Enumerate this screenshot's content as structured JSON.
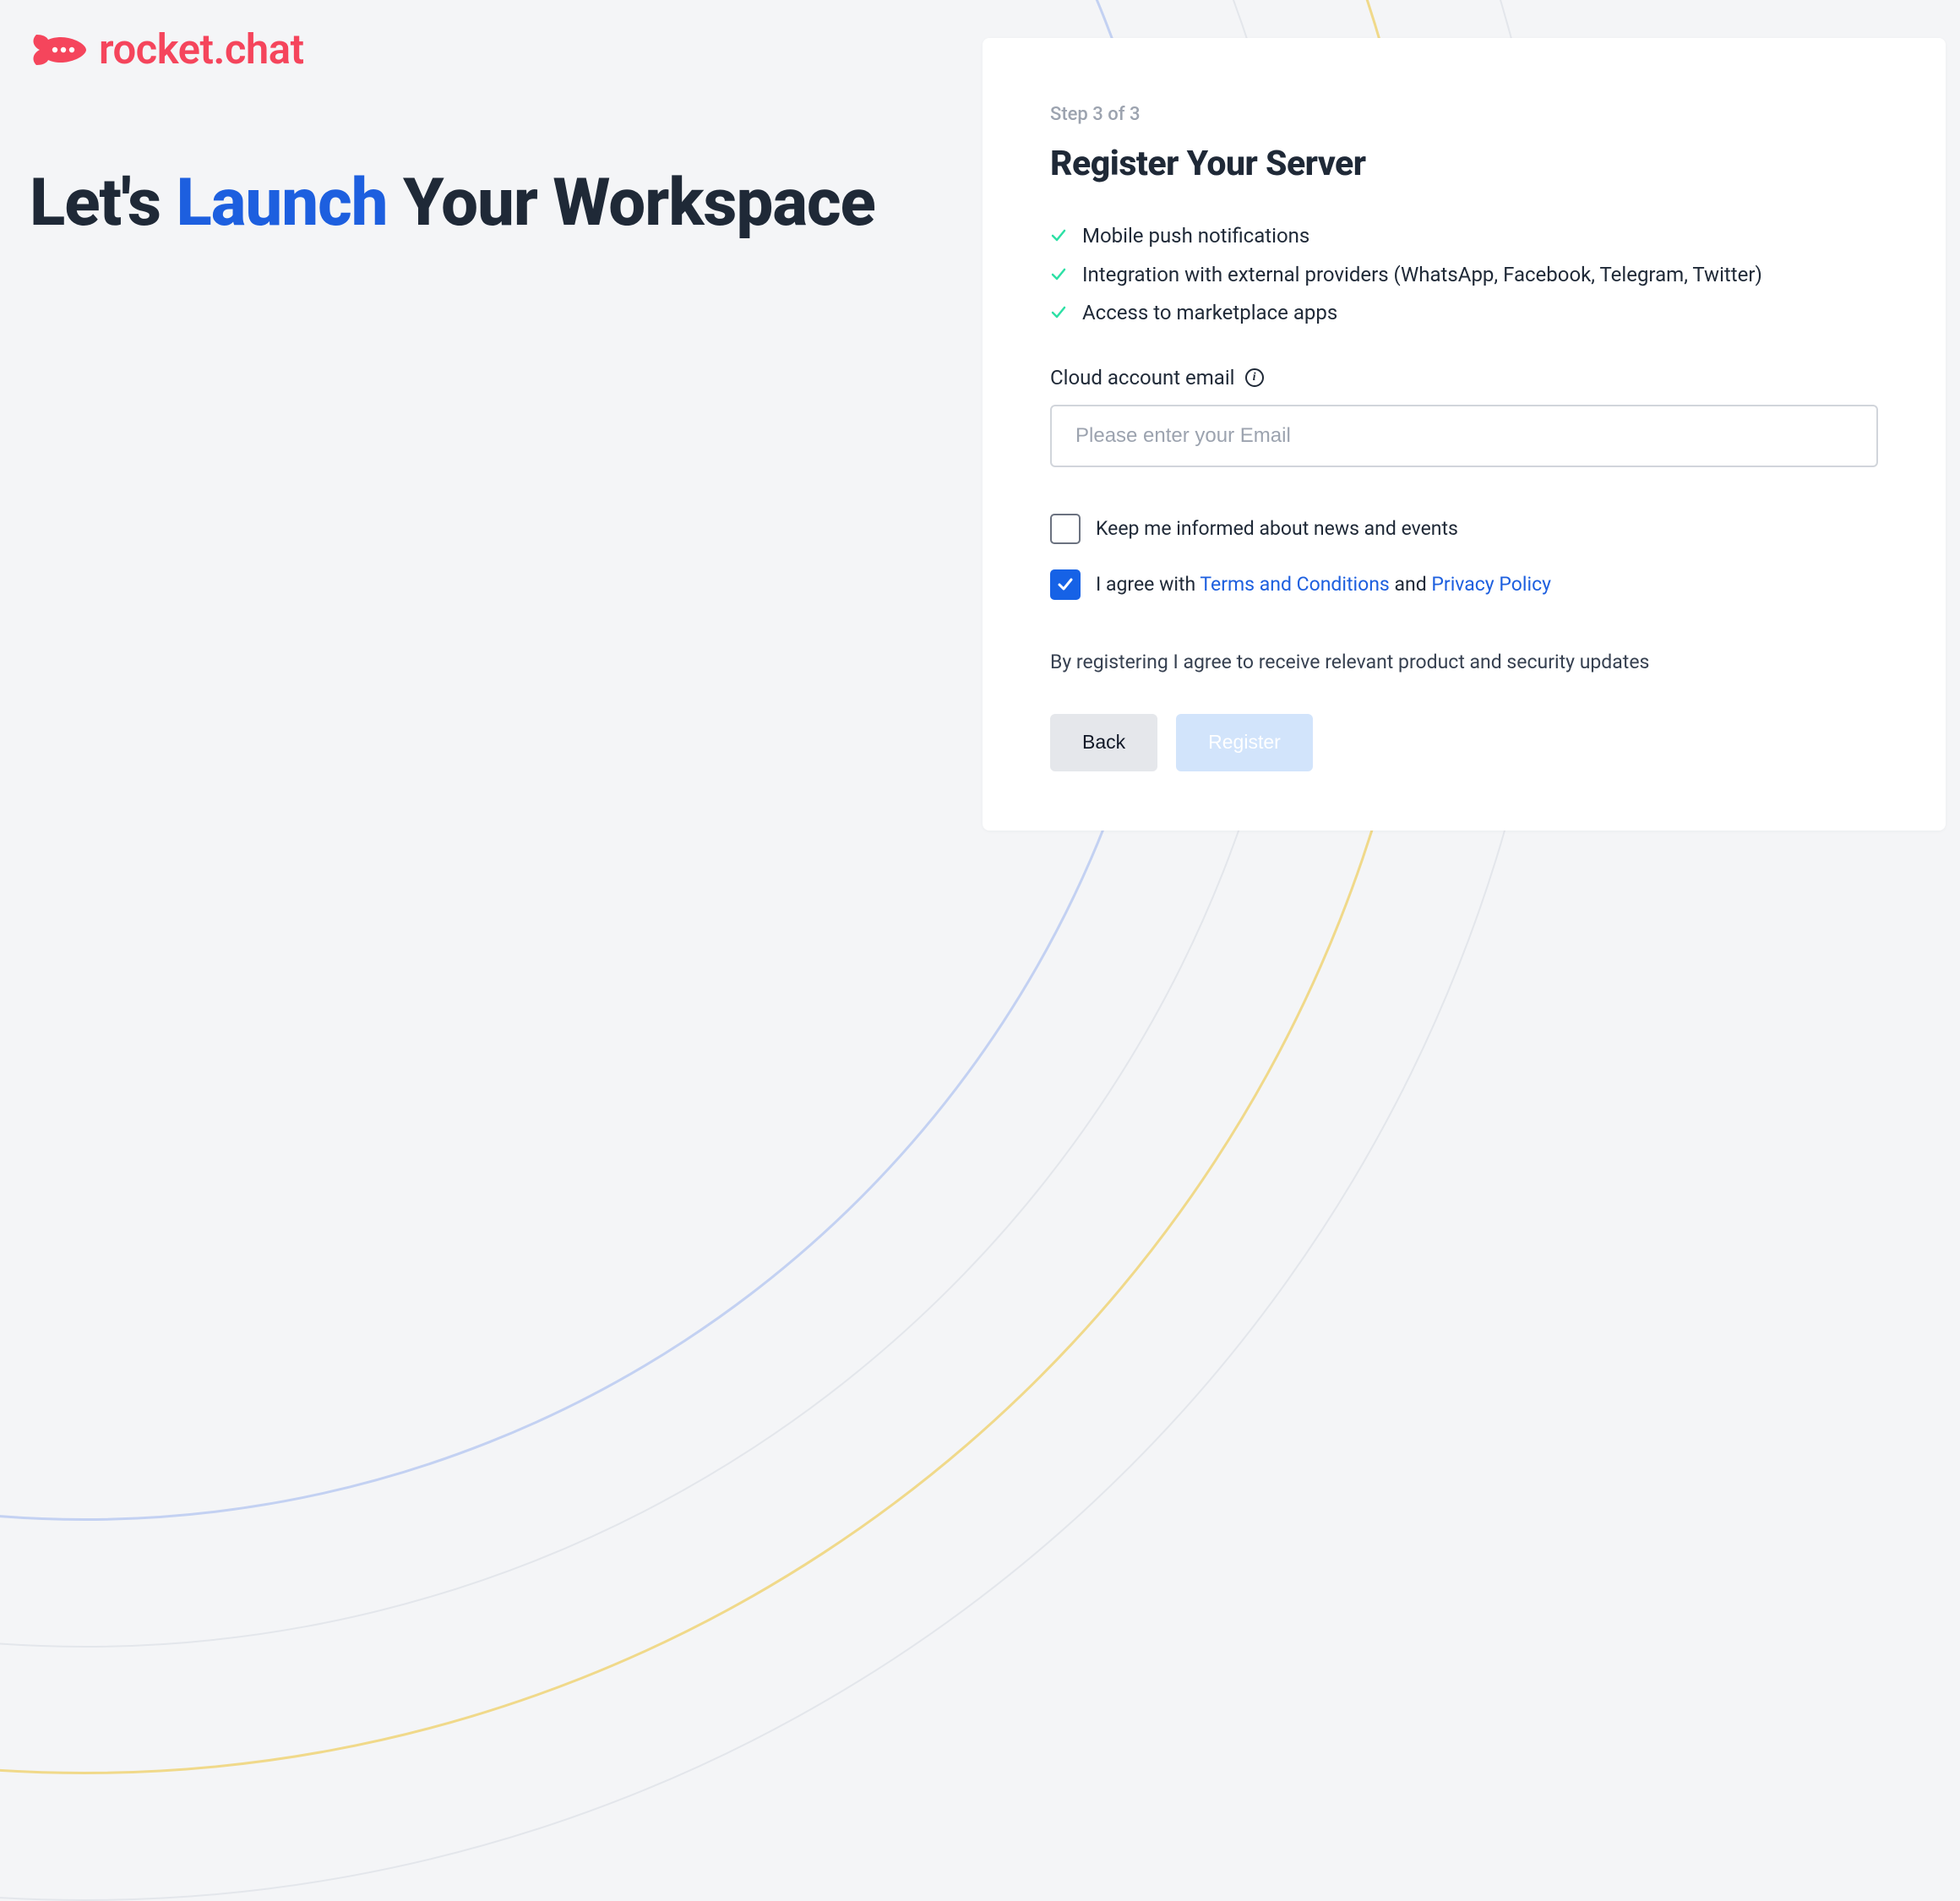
{
  "brand": {
    "name": "rocket.chat"
  },
  "hero": {
    "prefix": "Let's ",
    "accent": "Launch",
    "suffix": " Your Workspace"
  },
  "card": {
    "step_label": "Step 3 of 3",
    "title": "Register Your Server",
    "features": [
      "Mobile push notifications",
      "Integration with external providers (WhatsApp, Facebook, Telegram, Twitter)",
      "Access to marketplace apps"
    ],
    "email_field": {
      "label": "Cloud account email",
      "placeholder": "Please enter your Email",
      "value": ""
    },
    "checkbox_news": {
      "label": "Keep me informed about news and events",
      "checked": false
    },
    "checkbox_agree": {
      "prefix": "I agree with ",
      "terms_link": "Terms and Conditions",
      "mid": " and ",
      "privacy_link": "Privacy Policy",
      "checked": true
    },
    "disclaimer": "By registering I agree to receive relevant product and security updates",
    "buttons": {
      "back": "Back",
      "register": "Register"
    }
  }
}
